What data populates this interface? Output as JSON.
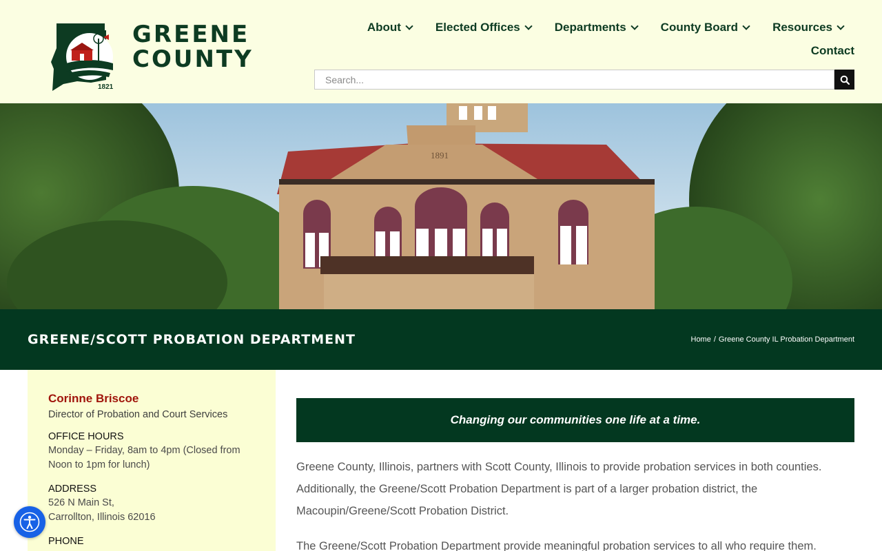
{
  "brand": {
    "line1": "GREENE",
    "line2": "COUNTY",
    "year": "1821",
    "color": "#0d3b22"
  },
  "nav": {
    "items": [
      {
        "label": "About"
      },
      {
        "label": "Elected Offices"
      },
      {
        "label": "Departments"
      },
      {
        "label": "County Board"
      },
      {
        "label": "Resources"
      }
    ],
    "contact": "Contact"
  },
  "search": {
    "placeholder": "Search..."
  },
  "hero": {
    "building_date": "1891"
  },
  "titlebar": {
    "title": "GREENE/SCOTT PROBATION DEPARTMENT",
    "breadcrumb_home": "Home",
    "breadcrumb_sep": "/",
    "breadcrumb_current": "Greene County IL Probation Department",
    "bg_color": "#033820"
  },
  "sidebar": {
    "name": "Corinne Briscoe",
    "role": "Director of Probation and Court Services",
    "hours_heading": "OFFICE HOURS",
    "hours_text": "Monday – Friday, 8am to 4pm (Closed from Noon to 1pm for lunch)",
    "address_heading": "ADDRESS",
    "address_line1": "526 N Main St,",
    "address_line2": "Carrollton, Illinois 62016",
    "phone_heading": "PHONE"
  },
  "main": {
    "tagline": "Changing our communities one life at a time.",
    "paragraph1": "Greene County, Illinois, partners with Scott County, Illinois to provide probation services in both counties. Additionally, the Greene/Scott Probation Department is part of a larger probation district, the Macoupin/Greene/Scott Probation District.",
    "paragraph2": "The Greene/Scott Probation Department provide meaningful probation services to all who require them."
  },
  "colors": {
    "accent_dark_green": "#033820",
    "header_bg": "#fbfee2",
    "sidebar_bg": "#fbfed4",
    "name_red": "#a0150b",
    "a11y_blue": "#1761e6"
  }
}
